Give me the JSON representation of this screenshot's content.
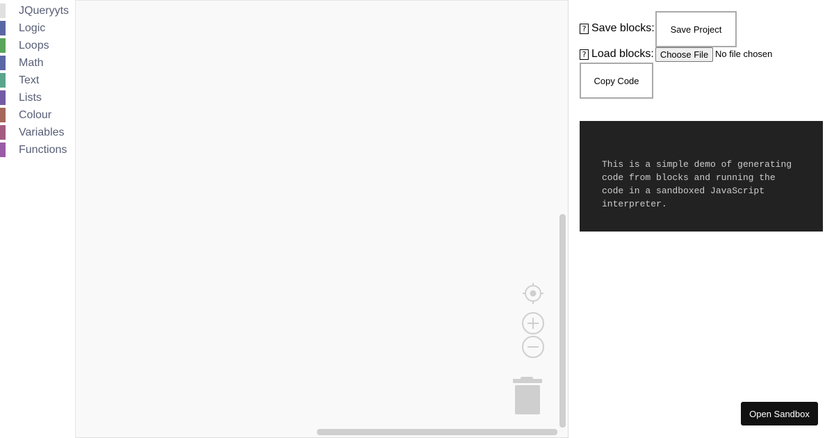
{
  "toolbox": {
    "categories": [
      {
        "label": "JQueryyts",
        "color": "#e0e0e0"
      },
      {
        "label": "Logic",
        "color": "#5b67a5"
      },
      {
        "label": "Loops",
        "color": "#5ba55b"
      },
      {
        "label": "Math",
        "color": "#5b67a5"
      },
      {
        "label": "Text",
        "color": "#5ba58c"
      },
      {
        "label": "Lists",
        "color": "#745ba5"
      },
      {
        "label": "Colour",
        "color": "#a5675b"
      },
      {
        "label": "Variables",
        "color": "#a55b80"
      },
      {
        "label": "Functions",
        "color": "#995ba5"
      }
    ]
  },
  "workspace": {
    "controls": [
      "recenter-icon",
      "zoom-in-icon",
      "zoom-out-icon",
      "trash-icon"
    ]
  },
  "panel": {
    "save_label": "Save blocks:",
    "save_button": "Save Project",
    "load_label": "Load blocks:",
    "file_button": "Choose File",
    "file_status": "No file chosen",
    "copy_button": "Copy Code",
    "missing_glyph": "?",
    "output_text": "This is a simple demo of generating\ncode from blocks and running the\ncode in a sandboxed JavaScript\ninterpreter.",
    "sandbox_button": "Open Sandbox"
  },
  "colors": {
    "output_bg": "#222222",
    "sandbox_bg": "#111111",
    "workspace_bg": "#f9f9f9"
  }
}
